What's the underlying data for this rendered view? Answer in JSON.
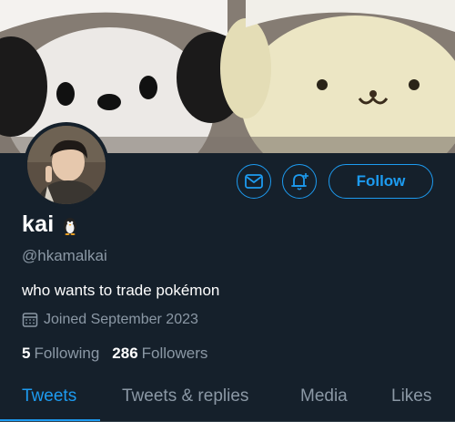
{
  "profile": {
    "name": "kai",
    "name_emoji": "penguin-emoji",
    "handle": "@hkamalkai",
    "bio": "who wants to trade pokémon",
    "joined": "Joined September 2023",
    "following_count": "5",
    "following_label": "Following",
    "followers_count": "286",
    "followers_label": "Followers"
  },
  "actions": {
    "message_icon": "mail-icon",
    "notify_icon": "bell-plus-icon",
    "follow_label": "Follow"
  },
  "tabs": [
    {
      "label": "Tweets",
      "active": true
    },
    {
      "label": "Tweets & replies",
      "active": false
    },
    {
      "label": "Media",
      "active": false
    },
    {
      "label": "Likes",
      "active": false
    }
  ],
  "colors": {
    "background": "#15202b",
    "accent": "#1d9bf0",
    "secondary_text": "#8b98a5"
  }
}
